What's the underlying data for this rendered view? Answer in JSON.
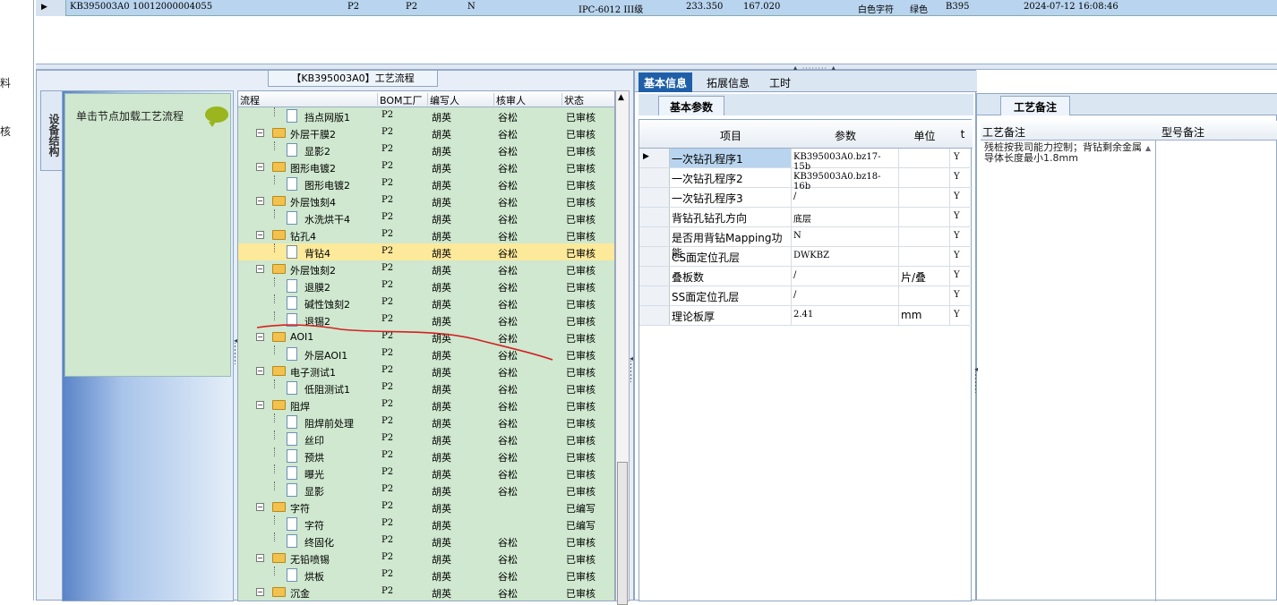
{
  "left_strip": {
    "labels": [
      "料",
      "核"
    ]
  },
  "top_grid": {
    "row": {
      "pn": "KB395003A0",
      "code": "10012000004055",
      "f1": "P2",
      "f2": "P2",
      "f3": "N",
      "spec": "IPC-6012 III级",
      "v1": "233.350",
      "v2": "167.020",
      "char_color": "白色字符",
      "color": "绿色",
      "code2": "B395",
      "datetime": "2024-07-12 16:08:46"
    }
  },
  "flow_panel": {
    "title": "【KB395003A0】工艺流程",
    "vertical_tab": "设备结构",
    "node_hint": "单击节点加载工艺流程",
    "headers": {
      "flow": "流程",
      "bom": "BOM工厂",
      "writer": "编写人",
      "reviewer": "核审人",
      "status": "状态"
    },
    "rows": [
      {
        "level": 2,
        "name": "挡点网版1",
        "bom": "P2",
        "writer": "胡英",
        "reviewer": "谷松",
        "status": "已审核"
      },
      {
        "level": 1,
        "name": "外层干膜2",
        "bom": "P2",
        "writer": "胡英",
        "reviewer": "谷松",
        "status": "已审核"
      },
      {
        "level": 2,
        "name": "显影2",
        "bom": "P2",
        "writer": "胡英",
        "reviewer": "谷松",
        "status": "已审核"
      },
      {
        "level": 1,
        "name": "图形电镀2",
        "bom": "P2",
        "writer": "胡英",
        "reviewer": "谷松",
        "status": "已审核"
      },
      {
        "level": 2,
        "name": "图形电镀2",
        "bom": "P2",
        "writer": "胡英",
        "reviewer": "谷松",
        "status": "已审核"
      },
      {
        "level": 1,
        "name": "外层蚀刻4",
        "bom": "P2",
        "writer": "胡英",
        "reviewer": "谷松",
        "status": "已审核"
      },
      {
        "level": 2,
        "name": "水洗烘干4",
        "bom": "P2",
        "writer": "胡英",
        "reviewer": "谷松",
        "status": "已审核"
      },
      {
        "level": 1,
        "name": "钻孔4",
        "bom": "P2",
        "writer": "胡英",
        "reviewer": "谷松",
        "status": "已审核"
      },
      {
        "level": 2,
        "name": "背钻4",
        "bom": "P2",
        "writer": "胡英",
        "reviewer": "谷松",
        "status": "已审核",
        "selected": true
      },
      {
        "level": 1,
        "name": "外层蚀刻2",
        "bom": "P2",
        "writer": "胡英",
        "reviewer": "谷松",
        "status": "已审核"
      },
      {
        "level": 2,
        "name": "退膜2",
        "bom": "P2",
        "writer": "胡英",
        "reviewer": "谷松",
        "status": "已审核"
      },
      {
        "level": 2,
        "name": "碱性蚀刻2",
        "bom": "P2",
        "writer": "胡英",
        "reviewer": "谷松",
        "status": "已审核"
      },
      {
        "level": 2,
        "name": "退锡2",
        "bom": "P2",
        "writer": "胡英",
        "reviewer": "谷松",
        "status": "已审核"
      },
      {
        "level": 1,
        "name": "AOI1",
        "bom": "P2",
        "writer": "胡英",
        "reviewer": "谷松",
        "status": "已审核"
      },
      {
        "level": 2,
        "name": "外层AOI1",
        "bom": "P2",
        "writer": "胡英",
        "reviewer": "谷松",
        "status": "已审核"
      },
      {
        "level": 1,
        "name": "电子测试1",
        "bom": "P2",
        "writer": "胡英",
        "reviewer": "谷松",
        "status": "已审核"
      },
      {
        "level": 2,
        "name": "低阻测试1",
        "bom": "P2",
        "writer": "胡英",
        "reviewer": "谷松",
        "status": "已审核"
      },
      {
        "level": 1,
        "name": "阻焊",
        "bom": "P2",
        "writer": "胡英",
        "reviewer": "谷松",
        "status": "已审核"
      },
      {
        "level": 2,
        "name": "阻焊前处理",
        "bom": "P2",
        "writer": "胡英",
        "reviewer": "谷松",
        "status": "已审核"
      },
      {
        "level": 2,
        "name": "丝印",
        "bom": "P2",
        "writer": "胡英",
        "reviewer": "谷松",
        "status": "已审核"
      },
      {
        "level": 2,
        "name": "预烘",
        "bom": "P2",
        "writer": "胡英",
        "reviewer": "谷松",
        "status": "已审核"
      },
      {
        "level": 2,
        "name": "曝光",
        "bom": "P2",
        "writer": "胡英",
        "reviewer": "谷松",
        "status": "已审核"
      },
      {
        "level": 2,
        "name": "显影",
        "bom": "P2",
        "writer": "胡英",
        "reviewer": "谷松",
        "status": "已审核"
      },
      {
        "level": 1,
        "name": "字符",
        "bom": "P2",
        "writer": "胡英",
        "reviewer": "",
        "status": "已编写"
      },
      {
        "level": 2,
        "name": "字符",
        "bom": "P2",
        "writer": "胡英",
        "reviewer": "",
        "status": "已编写"
      },
      {
        "level": 2,
        "name": "终固化",
        "bom": "P2",
        "writer": "胡英",
        "reviewer": "谷松",
        "status": "已审核"
      },
      {
        "level": 1,
        "name": "无铅喷锡",
        "bom": "P2",
        "writer": "胡英",
        "reviewer": "谷松",
        "status": "已审核"
      },
      {
        "level": 2,
        "name": "烘板",
        "bom": "P2",
        "writer": "胡英",
        "reviewer": "谷松",
        "status": "已审核"
      },
      {
        "level": 1,
        "name": "沉金",
        "bom": "P2",
        "writer": "胡英",
        "reviewer": "谷松",
        "status": "已审核"
      }
    ]
  },
  "info_panel": {
    "tabs": [
      "基本信息",
      "拓展信息",
      "工时"
    ],
    "sub_tab": "基本参数",
    "headers": {
      "item": "项目",
      "param": "参数",
      "unit": "单位",
      "flag": "t"
    },
    "rows": [
      {
        "item": "一次钻孔程序1",
        "param": "KB395003A0.bz17-15b",
        "unit": "",
        "flag": "Y"
      },
      {
        "item": "一次钻孔程序2",
        "param": "KB395003A0.bz18-16b",
        "unit": "",
        "flag": "Y"
      },
      {
        "item": "一次钻孔程序3",
        "param": "/",
        "unit": "",
        "flag": "Y"
      },
      {
        "item": "背钻孔钻孔方向",
        "param": "底层",
        "unit": "",
        "flag": "Y"
      },
      {
        "item": "是否用背钻Mapping功能",
        "param": "N",
        "unit": "",
        "flag": "Y"
      },
      {
        "item": "CS面定位孔层",
        "param": "DWKBZ",
        "unit": "",
        "flag": "Y"
      },
      {
        "item": "叠板数",
        "param": "/",
        "unit": "片/叠",
        "flag": "Y"
      },
      {
        "item": "SS面定位孔层",
        "param": "/",
        "unit": "",
        "flag": "Y"
      },
      {
        "item": "理论板厚",
        "param": "2.41",
        "unit": "mm",
        "flag": "Y"
      }
    ]
  },
  "remark_panel": {
    "tab": "工艺备注",
    "headers": {
      "remark": "工艺备注",
      "model_remark": "型号备注"
    },
    "remark_text": "残桩按我司能力控制；背钻剩余金属导体长度最小1.8mm"
  },
  "colors": {
    "tree_bg": "#cfe8cf",
    "selected_row": "#fde99a",
    "active_tab": "#1f5fa8",
    "annotation_stroke": "#d42020"
  }
}
